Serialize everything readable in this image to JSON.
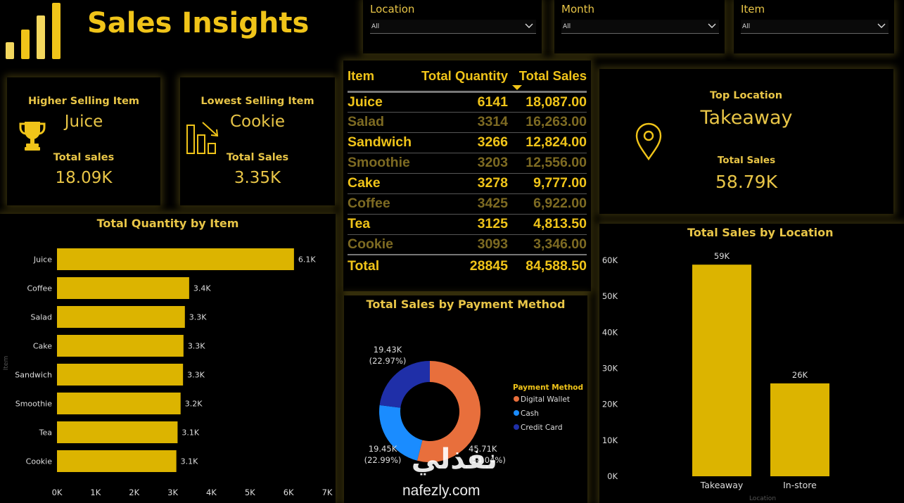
{
  "header": {
    "title": "Sales Insights"
  },
  "slicers": [
    {
      "label": "Location",
      "value": "All"
    },
    {
      "label": "Month",
      "value": "All"
    },
    {
      "label": "Item",
      "value": "All"
    }
  ],
  "kpi_high": {
    "title": "Higher Selling Item",
    "item": "Juice",
    "sub": "Total sales",
    "value": "18.09K",
    "icon": "trophy-icon"
  },
  "kpi_low": {
    "title": "Lowest Selling Item",
    "item": "Cookie",
    "sub": "Total Sales",
    "value": "3.35K",
    "icon": "declining-bar-chart-icon"
  },
  "kpi_top": {
    "title": "Top Location",
    "item": "Takeaway",
    "sub": "Total Sales",
    "value": "58.79K",
    "icon": "map-pin-icon"
  },
  "table": {
    "headers": {
      "item": "Item",
      "qty": "Total Quantity",
      "sales": "Total Sales"
    },
    "rows": [
      {
        "item": "Juice",
        "qty": "6141",
        "sales": "18,087.00"
      },
      {
        "item": "Salad",
        "qty": "3314",
        "sales": "16,263.00"
      },
      {
        "item": "Sandwich",
        "qty": "3266",
        "sales": "12,824.00"
      },
      {
        "item": "Smoothie",
        "qty": "3203",
        "sales": "12,556.00"
      },
      {
        "item": "Cake",
        "qty": "3278",
        "sales": "9,777.00"
      },
      {
        "item": "Coffee",
        "qty": "3425",
        "sales": "6,922.00"
      },
      {
        "item": "Tea",
        "qty": "3125",
        "sales": "4,813.50"
      },
      {
        "item": "Cookie",
        "qty": "3093",
        "sales": "3,346.00"
      }
    ],
    "total": {
      "label": "Total",
      "qty": "28845",
      "sales": "84,588.50"
    }
  },
  "watermark": {
    "arabic": "نفذلي",
    "latin": "nafezly.com"
  },
  "colors": {
    "accent": "#f0c419",
    "bar": "#dcb400",
    "digital_wallet": "#e86f3c",
    "cash": "#1a8cff",
    "credit_card": "#1f2fa8"
  },
  "chart_data": [
    {
      "id": "qty_by_item",
      "type": "bar",
      "orientation": "horizontal",
      "title": "Total Quantity by Item",
      "ylabel": "Item",
      "categories": [
        "Juice",
        "Coffee",
        "Salad",
        "Cake",
        "Sandwich",
        "Smoothie",
        "Tea",
        "Cookie"
      ],
      "values": [
        6141,
        3425,
        3314,
        3278,
        3266,
        3203,
        3125,
        3093
      ],
      "data_labels": [
        "6.1K",
        "3.4K",
        "3.3K",
        "3.3K",
        "3.3K",
        "3.2K",
        "3.1K",
        "3.1K"
      ],
      "xlim": [
        0,
        7000
      ],
      "xticks": [
        "0K",
        "1K",
        "2K",
        "3K",
        "4K",
        "5K",
        "6K",
        "7K"
      ]
    },
    {
      "id": "sales_by_payment",
      "type": "pie",
      "donut": true,
      "title": "Total Sales by Payment Method",
      "legend_title": "Payment Method",
      "legend_position": "right",
      "slices": [
        {
          "name": "Digital Wallet",
          "value": 45710,
          "label": "45.71K",
          "pct": "(54.04%)"
        },
        {
          "name": "Cash",
          "value": 19450,
          "label": "19.45K",
          "pct": "(22.99%)"
        },
        {
          "name": "Credit Card",
          "value": 19430,
          "label": "19.43K",
          "pct": "(22.97%)"
        }
      ]
    },
    {
      "id": "sales_by_location",
      "type": "bar",
      "title": "Total Sales by Location",
      "xlabel": "Location",
      "categories": [
        "Takeaway",
        "In-store"
      ],
      "values": [
        58790,
        25800
      ],
      "data_labels": [
        "59K",
        "26K"
      ],
      "ylim": [
        0,
        60000
      ],
      "yticks": [
        "0K",
        "10K",
        "20K",
        "30K",
        "40K",
        "50K",
        "60K"
      ]
    }
  ]
}
